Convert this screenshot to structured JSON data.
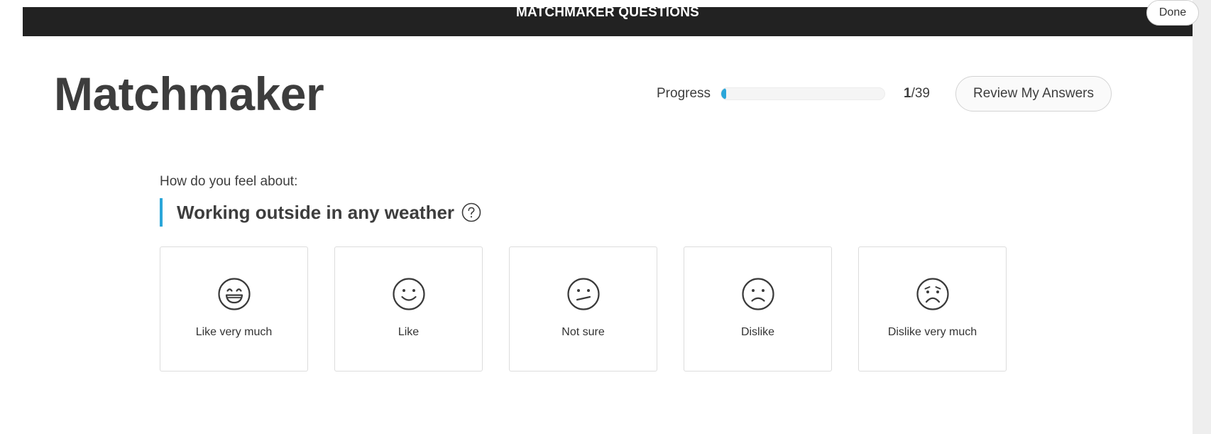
{
  "top_bar": {
    "title": "MATCHMAKER QUESTIONS",
    "done_label": "Done"
  },
  "header": {
    "title": "Matchmaker",
    "progress_label": "Progress",
    "progress_current": "1",
    "progress_total_text": "/39",
    "progress_fraction": 0.0256,
    "review_label": "Review My Answers"
  },
  "question": {
    "prompt": "How do you feel about:",
    "text": "Working outside in any weather",
    "help_icon": "question-circle-icon"
  },
  "options": [
    {
      "label": "Like very much",
      "icon": "grinning-face-icon"
    },
    {
      "label": "Like",
      "icon": "smiling-face-icon"
    },
    {
      "label": "Not sure",
      "icon": "unsure-face-icon"
    },
    {
      "label": "Dislike",
      "icon": "frowning-face-icon"
    },
    {
      "label": "Dislike very much",
      "icon": "very-sad-face-icon"
    }
  ],
  "colors": {
    "accent": "#2ba6d9",
    "top_bar": "#222222",
    "text": "#3d3d3d"
  }
}
